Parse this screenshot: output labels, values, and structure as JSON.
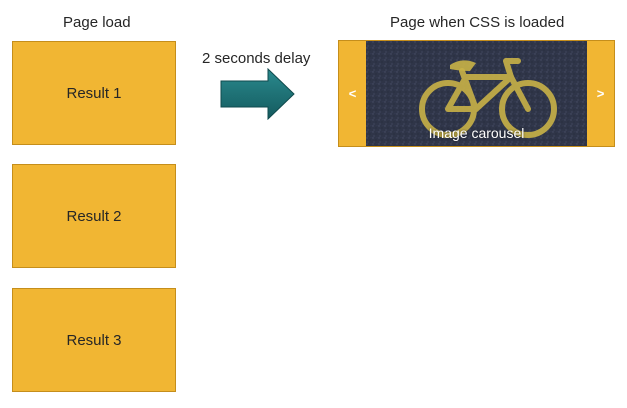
{
  "left": {
    "heading": "Page load",
    "results": [
      "Result 1",
      "Result 2",
      "Result 3"
    ]
  },
  "middle": {
    "delay_label": "2 seconds delay",
    "arrow_color": "#1c6e72"
  },
  "right": {
    "heading": "Page when CSS is loaded",
    "carousel": {
      "prev_label": "<",
      "next_label": ">",
      "caption": "Image carousel",
      "image_icon": "bicycle-icon"
    }
  },
  "colors": {
    "box_fill": "#f1b633",
    "box_border": "#c58e1b",
    "asphalt": "#2f3548",
    "bike_paint": "#c9b247"
  }
}
